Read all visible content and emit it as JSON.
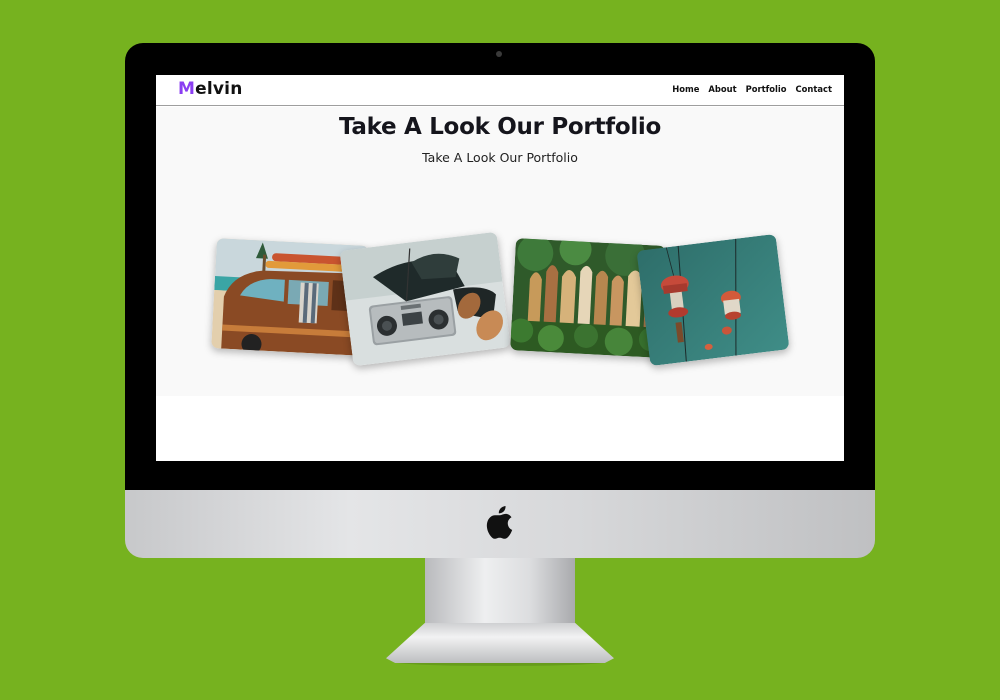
{
  "brand": {
    "initial": "M",
    "rest": "elvin"
  },
  "nav": {
    "items": [
      {
        "label": "Home"
      },
      {
        "label": "About"
      },
      {
        "label": "Portfolio"
      },
      {
        "label": "Contact"
      }
    ]
  },
  "hero": {
    "title": "Take A Look Our Portfolio",
    "subtitle": "Take A Look Our Portfolio"
  },
  "portfolio": {
    "items": [
      {
        "subject": "surf-van"
      },
      {
        "subject": "boombox-relaxing"
      },
      {
        "subject": "surfboard-fence"
      },
      {
        "subject": "hanging-lanterns"
      }
    ]
  },
  "colors": {
    "background": "#76b21f",
    "brand_accent": "#8b3ef2",
    "text": "#15151c",
    "hero_bg": "#f9f9f9"
  }
}
